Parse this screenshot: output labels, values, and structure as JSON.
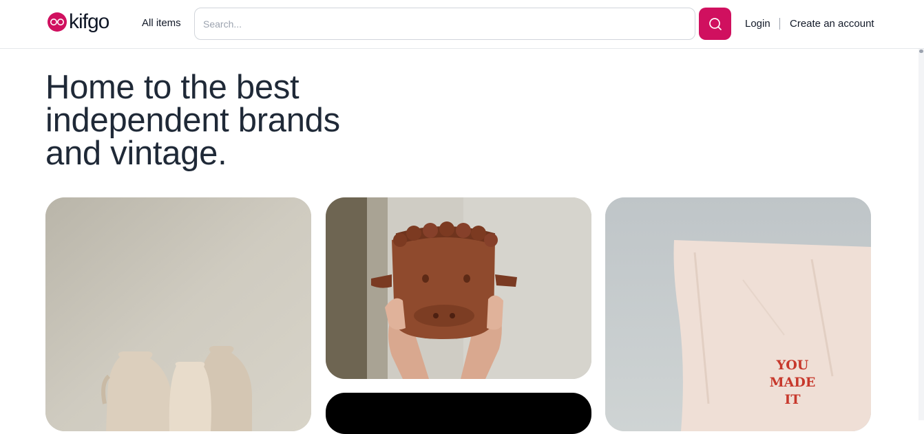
{
  "brand": {
    "name": "kifgo",
    "badge_text": "go",
    "accent_color": "#d0105f"
  },
  "nav": {
    "all_items": "All items",
    "login": "Login",
    "create_account": "Create an account"
  },
  "search": {
    "placeholder": "Search...",
    "value": "",
    "icon": "search-icon"
  },
  "hero": {
    "line1": "Home to the best",
    "line2": "independent brands",
    "line3": "and vintage."
  },
  "cards": [
    {
      "subject": "ceramic vases"
    },
    {
      "subject": "hands holding ceramic cow head"
    },
    {
      "subject": "dark image"
    },
    {
      "subject": "hanging fabric banner",
      "banner_lines": [
        "YOU",
        "MADE",
        "IT"
      ]
    }
  ]
}
